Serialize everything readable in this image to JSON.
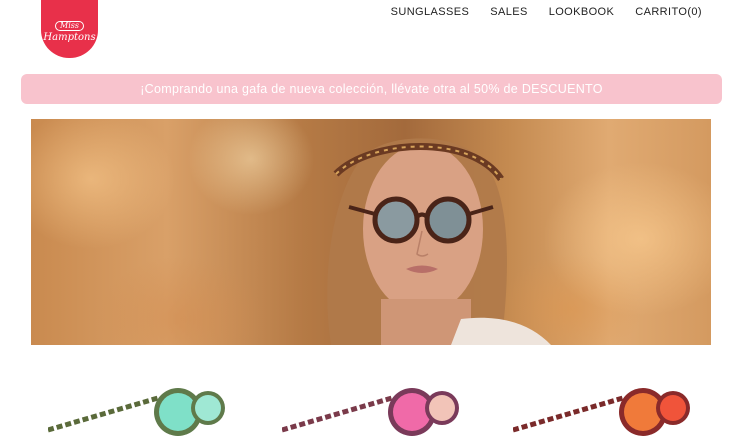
{
  "logo": {
    "line1": "Miss",
    "line2": "Hamptons"
  },
  "nav": {
    "items": [
      "SUNGLASSES",
      "SALES",
      "LOOKBOOK",
      "CARRITO(0)"
    ]
  },
  "promo": {
    "text": "¡Comprando una gafa de nueva colección, llévate otra al 50% de DESCUENTO"
  },
  "colors": {
    "brand": "#e8304a",
    "promo_bg": "#f8c3cd",
    "text": "#222222"
  },
  "products": [
    {
      "name": "sunglasses-mint",
      "lens_color": "#7fe0c8",
      "frame": "tortoise-green"
    },
    {
      "name": "sunglasses-pink",
      "lens_color": "#f06aa8",
      "frame": "tortoise-pink"
    },
    {
      "name": "sunglasses-orange",
      "lens_color": "#f07a3a",
      "frame": "tortoise-red"
    }
  ]
}
